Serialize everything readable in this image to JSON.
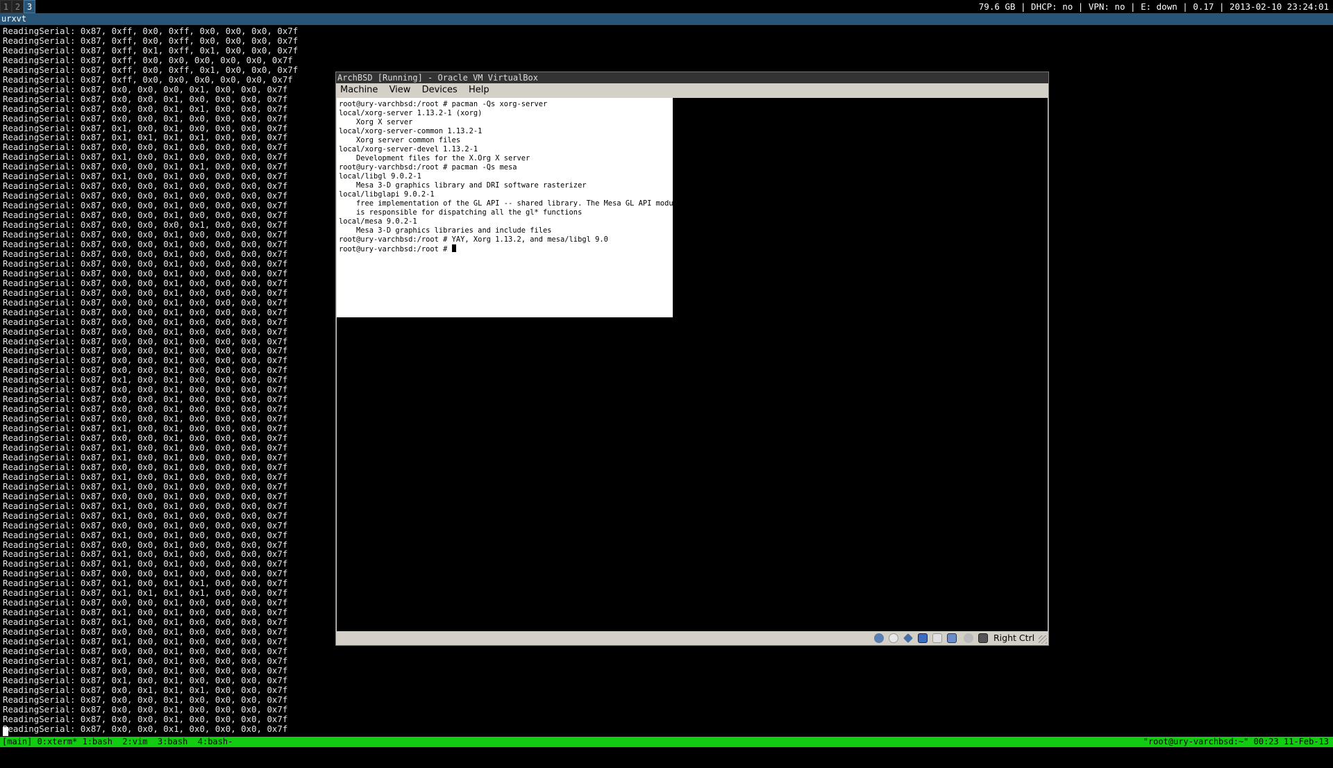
{
  "topbar": {
    "workspaces": [
      "1",
      "2",
      "3"
    ],
    "active_workspace": "3",
    "status": "79.6 GB | DHCP: no | VPN: no | E: down | 0.17 | 2013-02-10 23:24:01"
  },
  "window_title": "urxvt",
  "terminal": {
    "lines": [
      "ReadingSerial: 0x87, 0xff, 0x0, 0xff, 0x0, 0x0, 0x0, 0x7f",
      "ReadingSerial: 0x87, 0xff, 0x0, 0xff, 0x0, 0x0, 0x0, 0x7f",
      "ReadingSerial: 0x87, 0xff, 0x1, 0xff, 0x1, 0x0, 0x0, 0x7f",
      "ReadingSerial: 0x87, 0xff, 0x0, 0x0, 0x0, 0x0, 0x0, 0x7f",
      "ReadingSerial: 0x87, 0xff, 0x0, 0xff, 0x1, 0x0, 0x0, 0x7f",
      "ReadingSerial: 0x87, 0xff, 0x0, 0x0, 0x0, 0x0, 0x0, 0x7f",
      "ReadingSerial: 0x87, 0x0, 0x0, 0x0, 0x1, 0x0, 0x0, 0x7f",
      "ReadingSerial: 0x87, 0x0, 0x0, 0x1, 0x0, 0x0, 0x0, 0x7f",
      "ReadingSerial: 0x87, 0x0, 0x0, 0x1, 0x1, 0x0, 0x0, 0x7f",
      "ReadingSerial: 0x87, 0x0, 0x0, 0x1, 0x0, 0x0, 0x0, 0x7f",
      "ReadingSerial: 0x87, 0x1, 0x0, 0x1, 0x0, 0x0, 0x0, 0x7f",
      "ReadingSerial: 0x87, 0x1, 0x1, 0x1, 0x1, 0x0, 0x0, 0x7f",
      "ReadingSerial: 0x87, 0x0, 0x0, 0x1, 0x0, 0x0, 0x0, 0x7f",
      "ReadingSerial: 0x87, 0x1, 0x0, 0x1, 0x0, 0x0, 0x0, 0x7f",
      "ReadingSerial: 0x87, 0x0, 0x0, 0x1, 0x1, 0x0, 0x0, 0x7f",
      "ReadingSerial: 0x87, 0x1, 0x0, 0x1, 0x0, 0x0, 0x0, 0x7f",
      "ReadingSerial: 0x87, 0x0, 0x0, 0x1, 0x0, 0x0, 0x0, 0x7f",
      "ReadingSerial: 0x87, 0x0, 0x0, 0x1, 0x0, 0x0, 0x0, 0x7f",
      "ReadingSerial: 0x87, 0x0, 0x0, 0x1, 0x0, 0x0, 0x0, 0x7f",
      "ReadingSerial: 0x87, 0x0, 0x0, 0x1, 0x0, 0x0, 0x0, 0x7f",
      "ReadingSerial: 0x87, 0x0, 0x0, 0x0, 0x1, 0x0, 0x0, 0x7f",
      "ReadingSerial: 0x87, 0x0, 0x0, 0x1, 0x0, 0x0, 0x0, 0x7f",
      "ReadingSerial: 0x87, 0x0, 0x0, 0x1, 0x0, 0x0, 0x0, 0x7f",
      "ReadingSerial: 0x87, 0x0, 0x0, 0x1, 0x0, 0x0, 0x0, 0x7f",
      "ReadingSerial: 0x87, 0x0, 0x0, 0x1, 0x0, 0x0, 0x0, 0x7f",
      "ReadingSerial: 0x87, 0x0, 0x0, 0x1, 0x0, 0x0, 0x0, 0x7f",
      "ReadingSerial: 0x87, 0x0, 0x0, 0x1, 0x0, 0x0, 0x0, 0x7f",
      "ReadingSerial: 0x87, 0x0, 0x0, 0x1, 0x0, 0x0, 0x0, 0x7f",
      "ReadingSerial: 0x87, 0x0, 0x0, 0x1, 0x0, 0x0, 0x0, 0x7f",
      "ReadingSerial: 0x87, 0x0, 0x0, 0x1, 0x0, 0x0, 0x0, 0x7f",
      "ReadingSerial: 0x87, 0x0, 0x0, 0x1, 0x0, 0x0, 0x0, 0x7f",
      "ReadingSerial: 0x87, 0x0, 0x0, 0x1, 0x0, 0x0, 0x0, 0x7f",
      "ReadingSerial: 0x87, 0x0, 0x0, 0x1, 0x0, 0x0, 0x0, 0x7f",
      "ReadingSerial: 0x87, 0x0, 0x0, 0x1, 0x0, 0x0, 0x0, 0x7f",
      "ReadingSerial: 0x87, 0x0, 0x0, 0x1, 0x0, 0x0, 0x0, 0x7f",
      "ReadingSerial: 0x87, 0x0, 0x0, 0x1, 0x0, 0x0, 0x0, 0x7f",
      "ReadingSerial: 0x87, 0x1, 0x0, 0x1, 0x0, 0x0, 0x0, 0x7f",
      "ReadingSerial: 0x87, 0x0, 0x0, 0x1, 0x0, 0x0, 0x0, 0x7f",
      "ReadingSerial: 0x87, 0x0, 0x0, 0x1, 0x0, 0x0, 0x0, 0x7f",
      "ReadingSerial: 0x87, 0x0, 0x0, 0x1, 0x0, 0x0, 0x0, 0x7f",
      "ReadingSerial: 0x87, 0x0, 0x0, 0x1, 0x0, 0x0, 0x0, 0x7f",
      "ReadingSerial: 0x87, 0x1, 0x0, 0x1, 0x0, 0x0, 0x0, 0x7f",
      "ReadingSerial: 0x87, 0x0, 0x0, 0x1, 0x0, 0x0, 0x0, 0x7f",
      "ReadingSerial: 0x87, 0x1, 0x0, 0x1, 0x0, 0x0, 0x0, 0x7f",
      "ReadingSerial: 0x87, 0x1, 0x0, 0x1, 0x0, 0x0, 0x0, 0x7f",
      "ReadingSerial: 0x87, 0x0, 0x0, 0x1, 0x0, 0x0, 0x0, 0x7f",
      "ReadingSerial: 0x87, 0x1, 0x0, 0x1, 0x0, 0x0, 0x0, 0x7f",
      "ReadingSerial: 0x87, 0x1, 0x0, 0x1, 0x0, 0x0, 0x0, 0x7f",
      "ReadingSerial: 0x87, 0x0, 0x0, 0x1, 0x0, 0x0, 0x0, 0x7f",
      "ReadingSerial: 0x87, 0x1, 0x0, 0x1, 0x0, 0x0, 0x0, 0x7f",
      "ReadingSerial: 0x87, 0x1, 0x0, 0x1, 0x0, 0x0, 0x0, 0x7f",
      "ReadingSerial: 0x87, 0x0, 0x0, 0x1, 0x0, 0x0, 0x0, 0x7f",
      "ReadingSerial: 0x87, 0x1, 0x0, 0x1, 0x0, 0x0, 0x0, 0x7f",
      "ReadingSerial: 0x87, 0x0, 0x0, 0x1, 0x0, 0x0, 0x0, 0x7f",
      "ReadingSerial: 0x87, 0x1, 0x0, 0x1, 0x0, 0x0, 0x0, 0x7f",
      "ReadingSerial: 0x87, 0x1, 0x0, 0x1, 0x0, 0x0, 0x0, 0x7f",
      "ReadingSerial: 0x87, 0x0, 0x0, 0x1, 0x0, 0x0, 0x0, 0x7f",
      "ReadingSerial: 0x87, 0x1, 0x0, 0x1, 0x1, 0x0, 0x0, 0x7f",
      "ReadingSerial: 0x87, 0x1, 0x1, 0x1, 0x1, 0x0, 0x0, 0x7f",
      "ReadingSerial: 0x87, 0x0, 0x0, 0x1, 0x0, 0x0, 0x0, 0x7f",
      "ReadingSerial: 0x87, 0x1, 0x0, 0x1, 0x0, 0x0, 0x0, 0x7f",
      "ReadingSerial: 0x87, 0x1, 0x0, 0x1, 0x0, 0x0, 0x0, 0x7f",
      "ReadingSerial: 0x87, 0x0, 0x0, 0x1, 0x0, 0x0, 0x0, 0x7f",
      "ReadingSerial: 0x87, 0x1, 0x0, 0x1, 0x0, 0x0, 0x0, 0x7f",
      "ReadingSerial: 0x87, 0x0, 0x0, 0x1, 0x0, 0x0, 0x0, 0x7f",
      "ReadingSerial: 0x87, 0x1, 0x0, 0x1, 0x0, 0x0, 0x0, 0x7f",
      "ReadingSerial: 0x87, 0x0, 0x0, 0x1, 0x0, 0x0, 0x0, 0x7f",
      "ReadingSerial: 0x87, 0x1, 0x0, 0x1, 0x0, 0x0, 0x0, 0x7f",
      "ReadingSerial: 0x87, 0x0, 0x1, 0x1, 0x1, 0x0, 0x0, 0x7f",
      "ReadingSerial: 0x87, 0x0, 0x0, 0x1, 0x0, 0x0, 0x0, 0x7f",
      "ReadingSerial: 0x87, 0x0, 0x0, 0x1, 0x0, 0x0, 0x0, 0x7f",
      "ReadingSerial: 0x87, 0x0, 0x0, 0x1, 0x0, 0x0, 0x0, 0x7f",
      "ReadingSerial: 0x87, 0x0, 0x0, 0x1, 0x0, 0x0, 0x0, 0x7f"
    ]
  },
  "tmux": {
    "left": "[main] 0:xterm* 1:bash  2:vim  3:bash  4:bash-",
    "right": "\"root@ury-varchbsd:~\" 00:23 11-Feb-13"
  },
  "vbox": {
    "title": "ArchBSD [Running] - Oracle VM VirtualBox",
    "menu": [
      "Machine",
      "View",
      "Devices",
      "Help"
    ],
    "console_lines": [
      "root@ury-varchbsd:/root # pacman -Qs xorg-server",
      "local/xorg-server 1.13.2-1 (xorg)",
      "    Xorg X server",
      "local/xorg-server-common 1.13.2-1",
      "    Xorg server common files",
      "local/xorg-server-devel 1.13.2-1",
      "    Development files for the X.Org X server",
      "root@ury-varchbsd:/root # pacman -Qs mesa",
      "local/libgl 9.0.2-1",
      "    Mesa 3-D graphics library and DRI software rasterizer",
      "local/libglapi 9.0.2-1",
      "    free implementation of the GL API -- shared library. The Mesa GL API module",
      "    is responsible for dispatching all the gl* functions",
      "local/mesa 9.0.2-1",
      "    Mesa 3-D graphics libraries and include files",
      "root@ury-varchbsd:/root # YAY, Xorg 1.13.2, and mesa/libgl 9.0"
    ],
    "prompt": "root@ury-varchbsd:/root # ",
    "host_key": "Right Ctrl",
    "status_icons": [
      "hard-disk-icon",
      "optical-drive-icon",
      "usb-icon",
      "network-icon",
      "shared-folders-icon",
      "display-icon",
      "video-capture-icon",
      "mouse-integration-icon"
    ]
  }
}
